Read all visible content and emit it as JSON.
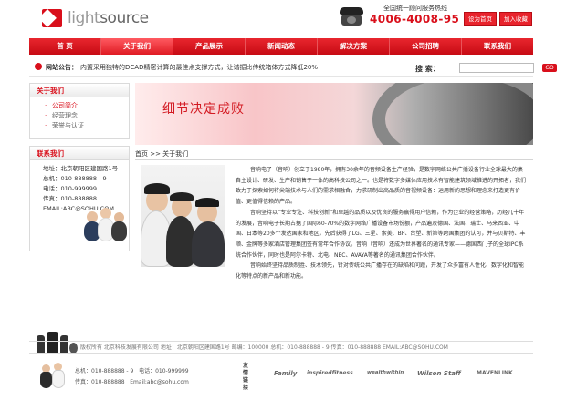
{
  "brand": {
    "logo_light": "light",
    "logo_bold": "source"
  },
  "hotline": {
    "label": "全国统一顾问服务热线",
    "number": "4006-4008-95"
  },
  "top_buttons": {
    "home": "设为首页",
    "favorite": "加入收藏"
  },
  "nav": [
    "首 页",
    "关于我们",
    "产品展示",
    "新闻动态",
    "解决方案",
    "公司招聘",
    "联系我们"
  ],
  "notice": {
    "label": "网站公告：",
    "text": "内置采用独特的DCAD精密计算的最佳点支撑方式，让谐振比传统箱体方式降低20%"
  },
  "search": {
    "label": "搜 索：",
    "button": "GO"
  },
  "sidebar": {
    "about_title": "关于我们",
    "about_links": [
      "公司简介",
      "经营理念",
      "荣誉与认证"
    ],
    "contact_title": "联系我们",
    "contact": [
      "地址：北京朝阳区建国路1号",
      "总机：010-888888 - 9",
      "电话：010-999999",
      "传真：010-888888",
      "EMAIL:ABC@SOHU.COM"
    ]
  },
  "banner": {
    "title": "细节决定成败"
  },
  "breadcrumb": "首页 >> 关于我们",
  "content": {
    "paragraphs": [
      "音响电子（音响）创立于1980年，拥有30余年的音频设备生产经验，是数字网络公共广播设备行业全球最大的集自主设计、研发、生产和销售于一体的高科技公司之一。也是将数字多媒体应用技术有智能建筑领域推进的开拓者，我们致力于探索如何将尖端技术与人们的需求相融合，力求研制出高品质的音视频设备：运用新的思想和理念来打造更有价值、更值得信赖的产品。",
      "音响坚持以“专业专注、科技创新”和卓越的品质以及优良的服务赢得用户信赖，作为企业的经营策略，历经几十年的发展，音响电子长期占据了国际60-70%的数字网络广播设备市场份额，产品遍及德国、法国、瑞士、马来西亚、中国、日本等20多个发达国家和地区。先后获得了LG、三星、索美、BP、台塑、新第等跨国集团的认可，并与贝斯特、丰顺、金牌等多家酒店管理集团签有常年合作协议。音响（音响）还成为世界著名的通讯专家——德国西门子的全球IPC系统合作伙伴，同时也是阿尔卡特、北电、NEC、AVAYA等著名的通讯集团合作伙伴。",
      "音响始终坚持品质制胜、技术领先，针对传统公共广播存在的缺陷和问题，开发了众多富有人性化、数字化和智能化等特点的新产品和新功能。"
    ]
  },
  "footer": {
    "line": "版权所有 北京科技发展有限公司 地址：北京朝阳区建国路1号 邮编：100000 总机：010-888888 - 9 传真：010-888888 EMAIL:ABC@SOHU.COM",
    "phone_main": "总机：010-888888 - 9",
    "phone": "电话：010-999999",
    "fax": "传真：010-888888",
    "email": "Email:abc@sohu.com",
    "partners_label": "友情链接",
    "partners": [
      "Family",
      "inspiredfitness",
      "wealthwithin",
      "Wilson Staff",
      "MAVENLINK"
    ]
  },
  "colors": {
    "accent": "#d90f1b",
    "nav": "#d11820"
  }
}
